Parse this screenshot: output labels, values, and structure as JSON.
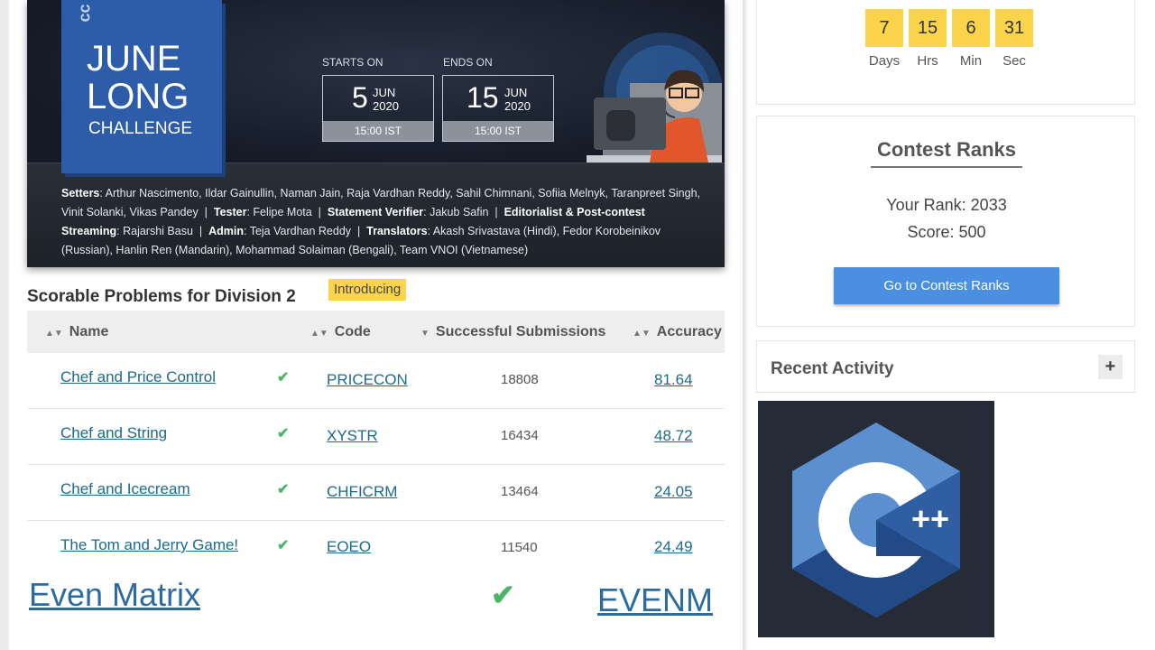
{
  "banner": {
    "title_line1": "JUNE",
    "title_line2": "LONG",
    "title_line3": "CHALLENGE",
    "starts_label": "STARTS ON",
    "ends_label": "ENDS ON",
    "start": {
      "day": "5",
      "month": "JUN",
      "year": "2020",
      "time": "15:00 IST"
    },
    "end": {
      "day": "15",
      "month": "JUN",
      "year": "2020",
      "time": "15:00 IST"
    },
    "credits": {
      "setters_label": "Setters",
      "setters": "Arthur Nascimento, Ildar Gainullin, Naman Jain, Raja Vardhan Reddy, Sahil Chimnani, Sofiia Melnyk, Taranpreet Singh, Vinit Solanki, Vikas Pandey",
      "tester_label": "Tester",
      "tester": "Felipe Mota",
      "verifier_label": "Statement Verifier",
      "verifier": "Jakub Safin",
      "editorialist_label": "Editorialist & Post-contest Streaming",
      "editorialist": "Rajarshi Basu",
      "admin_label": "Admin",
      "admin": "Teja Vardhan Reddy",
      "translators_label": "Translators",
      "translators": "Akash Srivastava (Hindi), Fedor Korobeinikov (Russian), Hanlin Ren (Mandarin), Mohammad Solaiman (Bengali), Team VNOI (Vietnamese)"
    }
  },
  "problems": {
    "section_title": "Scorable Problems for Division 2",
    "badge": "Introducing",
    "columns": {
      "name": "Name",
      "code": "Code",
      "submissions": "Successful Submissions",
      "accuracy": "Accuracy"
    },
    "rows": [
      {
        "name": "Chef and Price Control",
        "code": "PRICECON",
        "submissions": "18808",
        "accuracy": "81.64"
      },
      {
        "name": "Chef and String",
        "code": "XYSTR",
        "submissions": "16434",
        "accuracy": "48.72"
      },
      {
        "name": "Chef and Icecream",
        "code": "CHFICRM",
        "submissions": "13464",
        "accuracy": "24.05"
      },
      {
        "name": "The Tom and Jerry Game!",
        "code": "EOEO",
        "submissions": "11540",
        "accuracy": "24.49"
      }
    ],
    "zoomed_row": {
      "name": "Even Matrix",
      "code": "EVENM"
    },
    "check_glyph": "✔"
  },
  "countdown": {
    "days": "7",
    "hrs": "15",
    "min": "6",
    "sec": "31",
    "days_label": "Days",
    "hrs_label": "Hrs",
    "min_label": "Min",
    "sec_label": "Sec"
  },
  "ranks": {
    "title": "Contest Ranks",
    "your_rank": "Your Rank: 2033",
    "score": "Score: 500",
    "button_label": "Go to Contest Ranks"
  },
  "activity": {
    "title": "Recent Activity",
    "expand_glyph": "+"
  },
  "colors": {
    "accent_yellow": "#fbd44b",
    "link_blue": "#1d6a8a",
    "button_blue": "#4a8fe0",
    "check_green": "#4db56a",
    "banner_blue": "#2d5ca8"
  }
}
